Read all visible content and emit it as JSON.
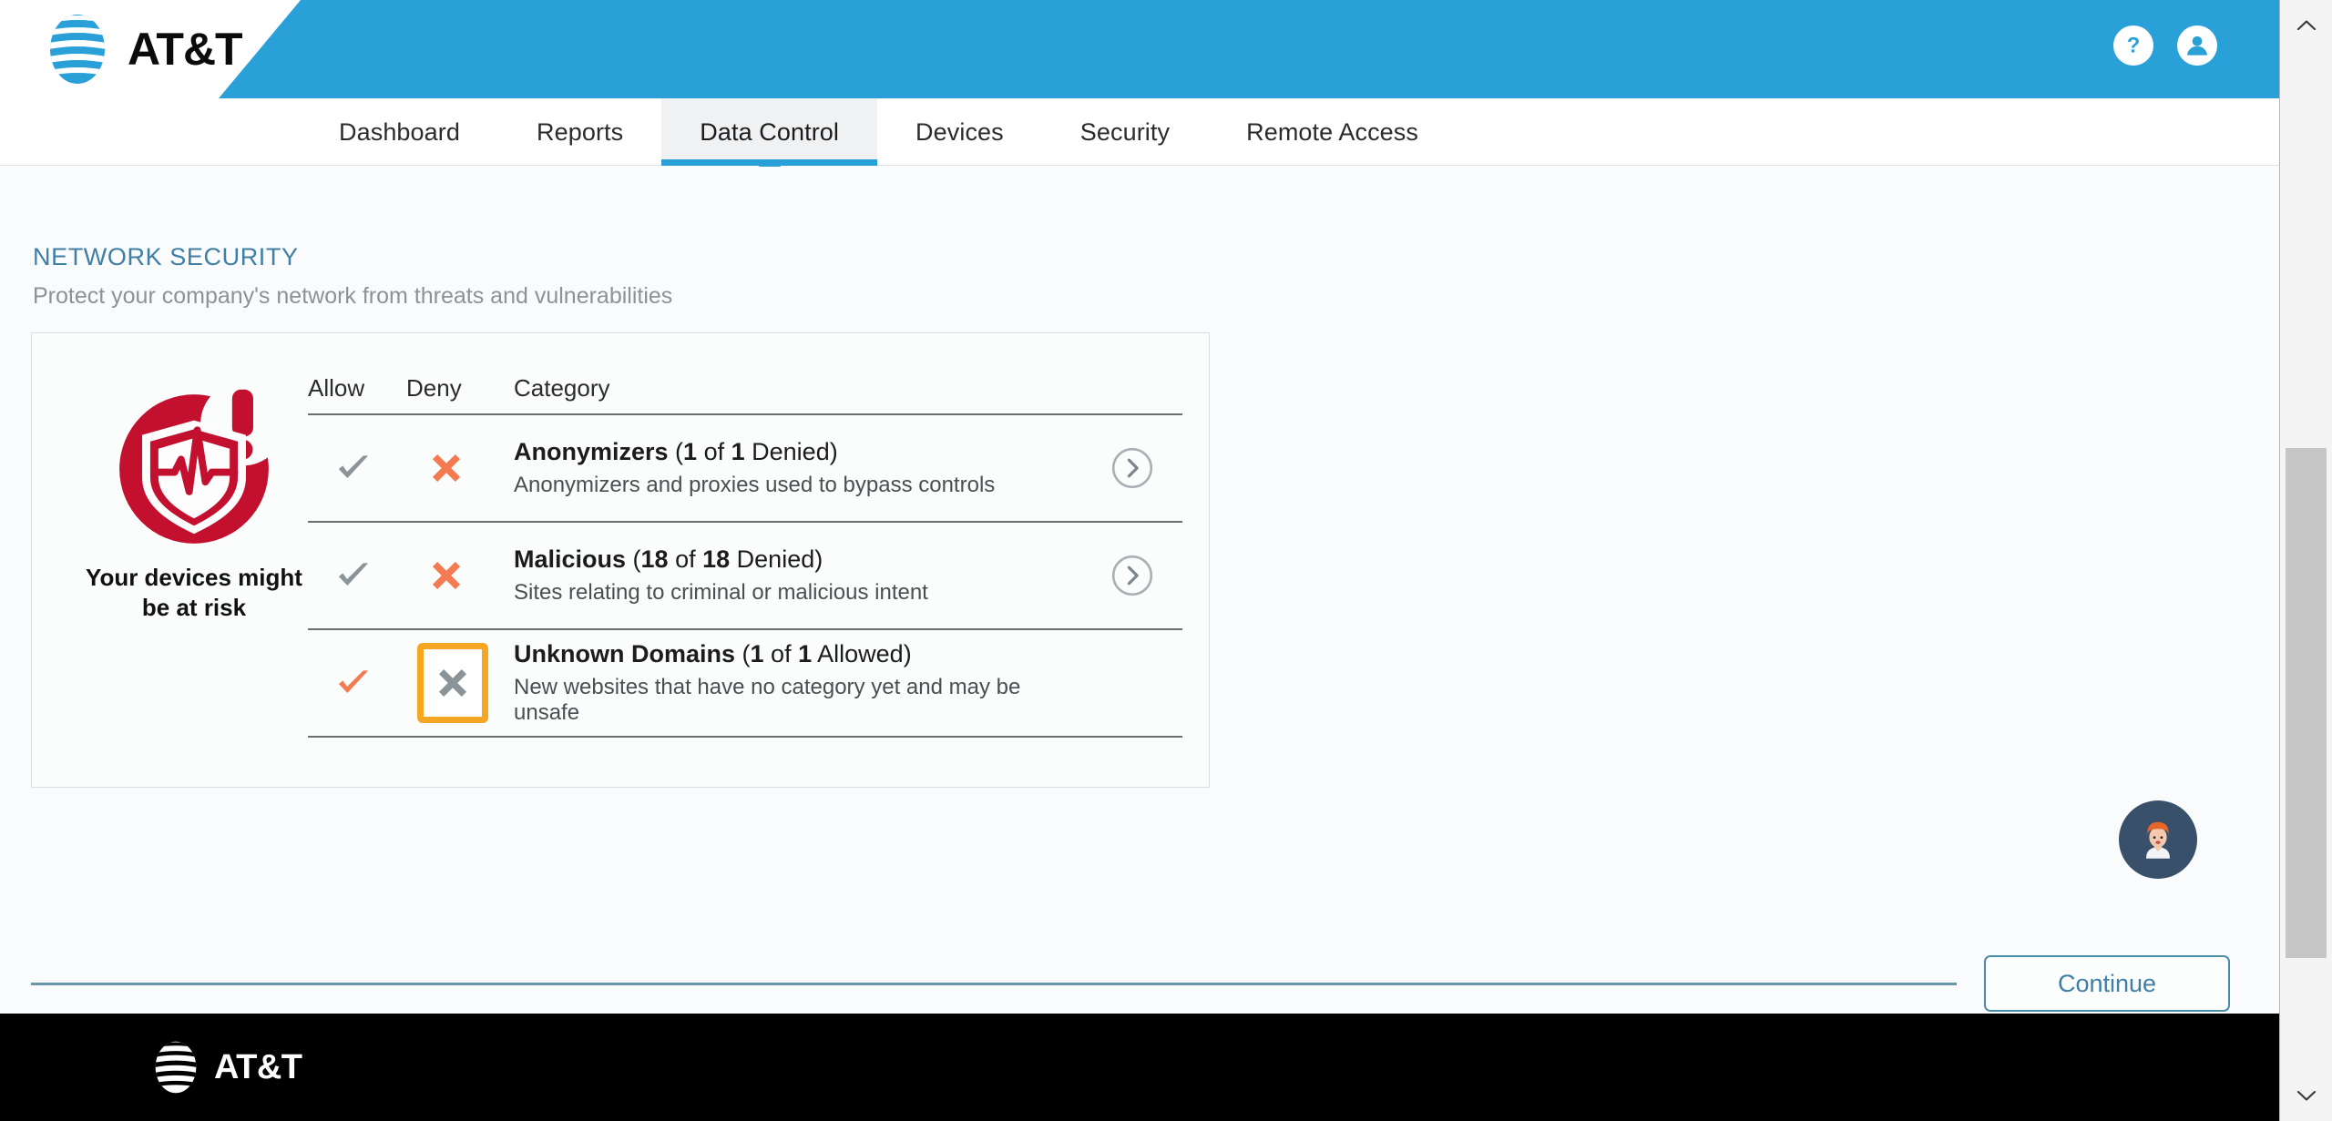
{
  "header": {
    "brand": "AT&T",
    "help_icon": "question-circle-icon",
    "account_icon": "user-circle-icon",
    "brand_blue": "#2aa0d8"
  },
  "nav": {
    "tabs": [
      {
        "label": "Dashboard",
        "active": false
      },
      {
        "label": "Reports",
        "active": false
      },
      {
        "label": "Data Control",
        "active": true
      },
      {
        "label": "Devices",
        "active": false
      },
      {
        "label": "Security",
        "active": false
      },
      {
        "label": "Remote Access",
        "active": false
      }
    ]
  },
  "page": {
    "title": "NETWORK SECURITY",
    "subtitle": "Protect your company's network from threats and vulnerabilities",
    "title_color": "#3f7fa5"
  },
  "risk": {
    "icon": "shield-alert-pulse-icon",
    "message_line1": "Your devices might",
    "message_line2": "be at risk",
    "icon_color": "#c2102e"
  },
  "table": {
    "headers": {
      "allow": "Allow",
      "deny": "Deny",
      "category": "Category"
    },
    "rows": [
      {
        "name": "Anonymizers",
        "count_current": "1",
        "count_total": "1",
        "state_label": "Denied",
        "description": "Anonymizers and proxies used to bypass controls",
        "allow_active": false,
        "deny_active": true,
        "focused_control": null,
        "arrow_icon": "chevron-right-circle-icon"
      },
      {
        "name": "Malicious",
        "count_current": "18",
        "count_total": "18",
        "state_label": "Denied",
        "description": "Sites relating to criminal or malicious intent",
        "allow_active": false,
        "deny_active": true,
        "focused_control": null,
        "arrow_icon": "chevron-right-circle-icon"
      },
      {
        "name": "Unknown Domains",
        "count_current": "1",
        "count_total": "1",
        "state_label": "Allowed",
        "description": "New websites that have no category yet and may be unsafe",
        "allow_active": true,
        "deny_active": false,
        "focused_control": "deny",
        "arrow_icon": null
      }
    ],
    "active_color": "#f47a52",
    "inactive_color": "#8b9499",
    "focus_outline_color": "#f5a623"
  },
  "actions": {
    "continue_label": "Continue",
    "continue_color": "#3f7fa5"
  },
  "assistant": {
    "icon": "virtual-assistant-avatar-icon",
    "background": "#39506b"
  },
  "footer": {
    "brand": "AT&T"
  },
  "scrollbar": {
    "up_icon": "chevron-up-icon",
    "down_icon": "chevron-down-icon"
  }
}
